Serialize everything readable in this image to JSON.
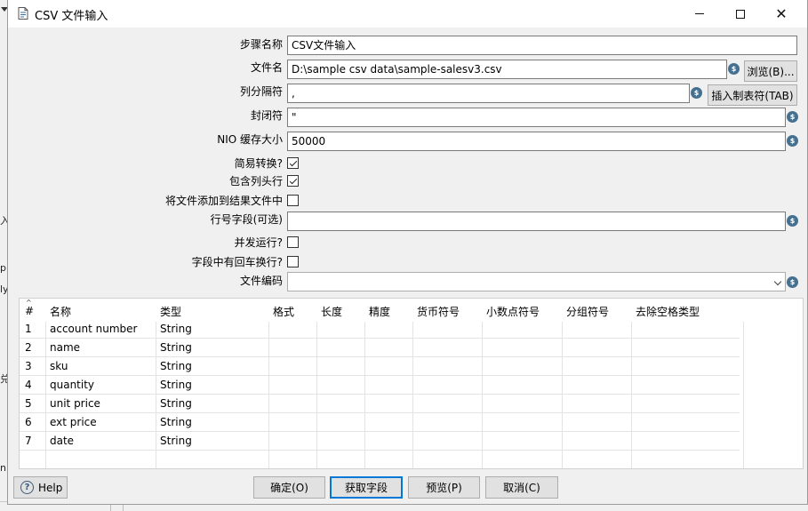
{
  "background_app": {
    "fragments": [
      "▸",
      "入",
      "p",
      "ly",
      "n",
      "兑"
    ]
  },
  "window": {
    "title": "CSV 文件输入",
    "controls": {
      "minimize": "—",
      "maximize": "☐",
      "close": "✕"
    }
  },
  "form": {
    "step_name": {
      "label": "步骤名称",
      "value": "CSV文件输入"
    },
    "filename": {
      "label": "文件名",
      "value": "D:\\sample csv data\\sample-salesv3.csv",
      "browse_label": "浏览(B)..."
    },
    "delimiter": {
      "label": "列分隔符",
      "value": ",",
      "insert_tab_label": "插入制表符(TAB)"
    },
    "enclosure": {
      "label": "封闭符",
      "value": "\""
    },
    "nio_buffer": {
      "label": "NIO 缓存大小",
      "value": "50000"
    },
    "lazy_conversion": {
      "label": "简易转换?",
      "checked": true
    },
    "header_row": {
      "label": "包含列头行",
      "checked": true
    },
    "add_to_result": {
      "label": "将文件添加到结果文件中",
      "checked": false
    },
    "row_number_field": {
      "label": "行号字段(可选)",
      "value": ""
    },
    "parallel": {
      "label": "并发运行?",
      "checked": false
    },
    "newline_in_fields": {
      "label": "字段中有回车换行?",
      "checked": false
    },
    "encoding": {
      "label": "文件编码",
      "value": ""
    },
    "variable_icon": "$"
  },
  "table": {
    "columns": [
      "#",
      "名称",
      "类型",
      "格式",
      "长度",
      "精度",
      "货币符号",
      "小数点符号",
      "分组符号",
      "去除空格类型"
    ],
    "rows": [
      [
        "1",
        "account number",
        "String"
      ],
      [
        "2",
        "name",
        "String"
      ],
      [
        "3",
        "sku",
        "String"
      ],
      [
        "4",
        "quantity",
        "String"
      ],
      [
        "5",
        "unit price",
        "String"
      ],
      [
        "6",
        "ext price",
        "String"
      ],
      [
        "7",
        "date",
        "String"
      ]
    ],
    "sort_glyph": "^"
  },
  "buttons": {
    "help": "Help",
    "help_icon": "?",
    "ok": "确定(O)",
    "get_fields": "获取字段",
    "preview": "预览(P)",
    "cancel": "取消(C)"
  }
}
